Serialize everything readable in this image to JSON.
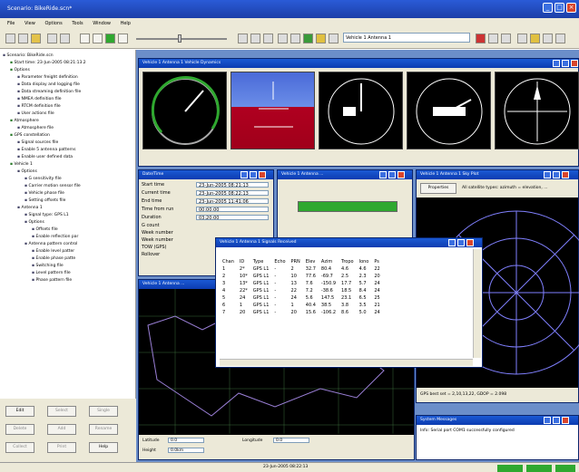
{
  "app": {
    "title": "Scenario: BikeRide.scn*"
  },
  "menu": [
    "File",
    "View",
    "Options",
    "Tools",
    "Window",
    "Help"
  ],
  "toolbar": {
    "vehicle_select": "Vehicle 1 Antenna 1"
  },
  "tree": {
    "items": [
      {
        "label": "Scenario: BikeRide.scn",
        "indent": 0
      },
      {
        "label": "Start time: 23-Jun-2005 08:21:13.2",
        "indent": 1
      },
      {
        "label": "Options",
        "indent": 1
      },
      {
        "label": "Parameter freight definition",
        "indent": 2
      },
      {
        "label": "Data display and logging file",
        "indent": 2
      },
      {
        "label": "Data streaming definition file",
        "indent": 2
      },
      {
        "label": "NMEA definition file",
        "indent": 2
      },
      {
        "label": "RTCM definition file",
        "indent": 2
      },
      {
        "label": "User actions file",
        "indent": 2
      },
      {
        "label": "Atmosphere",
        "indent": 1
      },
      {
        "label": "Atmosphere file",
        "indent": 2
      },
      {
        "label": "GPS constellation",
        "indent": 1
      },
      {
        "label": "Signal sources file",
        "indent": 2
      },
      {
        "label": "Enable 5 antenna patterns",
        "indent": 2
      },
      {
        "label": "Enable user defined data",
        "indent": 2
      },
      {
        "label": "Vehicle 1",
        "indent": 1
      },
      {
        "label": "Options",
        "indent": 2
      },
      {
        "label": "G sensitivity file",
        "indent": 3
      },
      {
        "label": "Carrier motion sensor file",
        "indent": 3
      },
      {
        "label": "Vehicle phase file",
        "indent": 3
      },
      {
        "label": "Setting offsets file",
        "indent": 3
      },
      {
        "label": "Antenna 1",
        "indent": 2
      },
      {
        "label": "Signal type: GPS L1",
        "indent": 3
      },
      {
        "label": "Options",
        "indent": 3
      },
      {
        "label": "Offsets file",
        "indent": 4
      },
      {
        "label": "Enable reflection par",
        "indent": 4
      },
      {
        "label": "Antenna pattern control",
        "indent": 3
      },
      {
        "label": "Enable level patter",
        "indent": 4
      },
      {
        "label": "Enable phase patte",
        "indent": 4
      },
      {
        "label": "Switching file",
        "indent": 4
      },
      {
        "label": "Level pattern file",
        "indent": 4
      },
      {
        "label": "Phase pattern file",
        "indent": 4
      }
    ],
    "buttons": {
      "edit": "Edit",
      "select": "Select",
      "single": "Single",
      "delete": "Delete",
      "add": "Add",
      "rename": "Rename",
      "collect": "Collect",
      "print": "Print",
      "help": "Help"
    }
  },
  "windows": {
    "dynamics": {
      "title": "Vehicle 1 Antenna 1 Vehicle Dynamics"
    },
    "datetime": {
      "title": "Date/Time",
      "rows": [
        {
          "label": "Start time",
          "value": "23-Jun-2005 08:21:13"
        },
        {
          "label": "Current time",
          "value": "23-Jun-2005 08:22:13"
        },
        {
          "label": "End time",
          "value": "23-Jun-2005 11:41:06"
        },
        {
          "label": "Time from run",
          "value": "00:00:00"
        },
        {
          "label": "Duration",
          "value": "03:20:00"
        }
      ],
      "rows2": [
        "G count",
        "Week number",
        "Week number",
        "TOW (GPS)",
        "Rollover"
      ]
    },
    "antenna_bar": {
      "title": "Vehicle 1 Antenna ..."
    },
    "skyplot": {
      "title": "Vehicle 1 Antenna 1 Sky Plot",
      "properties_btn": "Properties",
      "info": "All satellite types: azimuth = elevation, ...",
      "status": "GPS best set = 2,10,13,22, GDOP = 2.098"
    },
    "signals": {
      "title": "Vehicle 1 Antenna 1 Signals Received",
      "headers": [
        "Chan",
        "ID",
        "Type",
        "Echo",
        "PRN",
        "Elev",
        "Azim",
        "Tropo",
        "Iono",
        "Ps"
      ],
      "rows": [
        [
          "1",
          "2*",
          "GPS L1",
          "-",
          "2",
          "32.7",
          "80.4",
          "4.6",
          "4.6",
          "22"
        ],
        [
          "2",
          "10*",
          "GPS L1",
          "-",
          "10",
          "77.6",
          "-69.7",
          "2.5",
          "2.3",
          "20"
        ],
        [
          "3",
          "13*",
          "GPS L1",
          "-",
          "13",
          "7.6",
          "-150.9",
          "17.7",
          "5.7",
          "24"
        ],
        [
          "4",
          "22*",
          "GPS L1",
          "-",
          "22",
          "7.2",
          "-38.6",
          "18.5",
          "8.4",
          "24"
        ],
        [
          "5",
          "24",
          "GPS L1",
          "-",
          "24",
          "5.6",
          "147.5",
          "23.1",
          "6.5",
          "25"
        ],
        [
          "6",
          "1",
          "GPS L1",
          "-",
          "1",
          "40.4",
          "38.5",
          "3.8",
          "3.5",
          "21"
        ],
        [
          "7",
          "20",
          "GPS L1",
          "-",
          "20",
          "15.6",
          "-106.2",
          "8.6",
          "5.0",
          "24"
        ]
      ]
    },
    "map": {
      "title": "Vehicle 1 Antenna ...",
      "latitude_label": "Latitude",
      "latitude": "0.0",
      "longitude_label": "Longitude",
      "longitude": "0.0",
      "height_label": "Height",
      "height": "0.0km"
    },
    "messages": {
      "title": "System Messages",
      "text": "Info: Serial port COM1 successfully configured"
    }
  },
  "status": {
    "center": "23-Jun-2005 08:22:13"
  }
}
